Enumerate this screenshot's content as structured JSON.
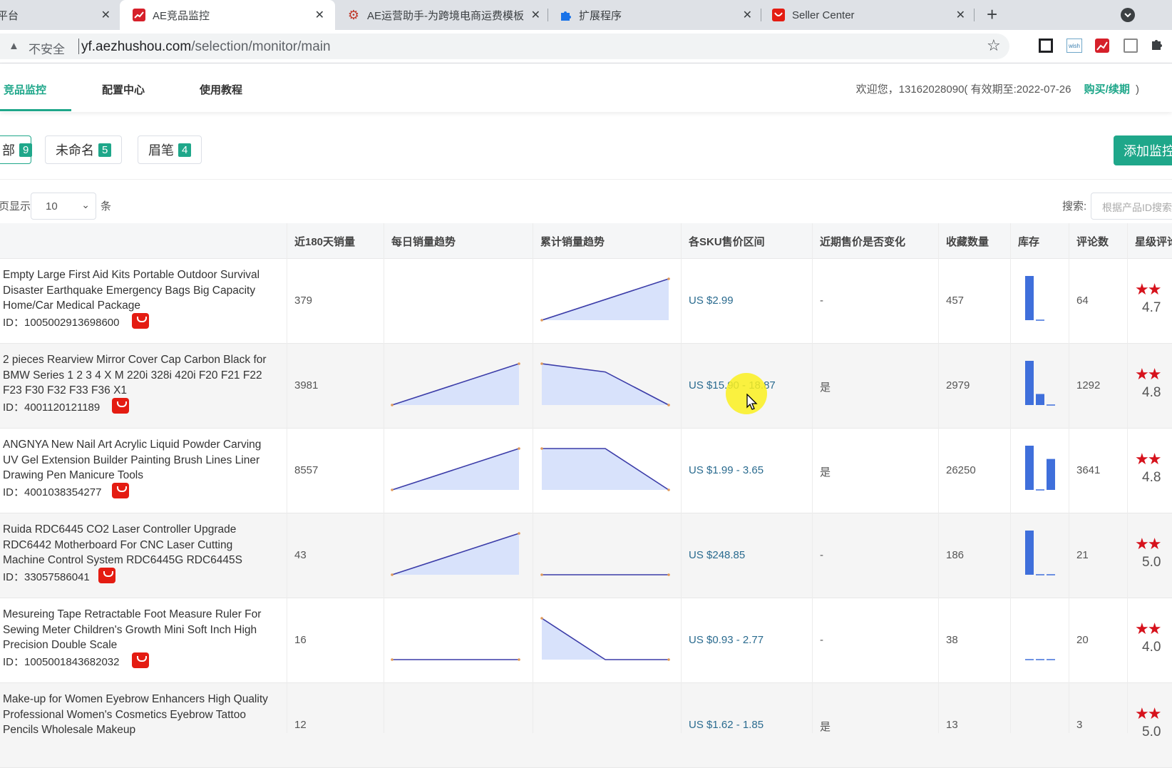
{
  "browser": {
    "tabs": [
      {
        "title": "平台",
        "active": false,
        "icon": "partial-tab"
      },
      {
        "title": "AE竞品监控",
        "active": true,
        "icon": "chart-icon"
      },
      {
        "title": "AE运营助手-为跨境电商运费模板",
        "active": false,
        "icon": "gear-icon"
      },
      {
        "title": "扩展程序",
        "active": false,
        "icon": "puzzle-icon"
      },
      {
        "title": "Seller Center",
        "active": false,
        "icon": "aliexpress-icon"
      }
    ],
    "security_label": "不安全",
    "url_host": "yf.aezhushou.com",
    "url_path": "/selection/monitor/main"
  },
  "app": {
    "nav": [
      {
        "label": "竞品监控",
        "active": true
      },
      {
        "label": "配置中心",
        "active": false
      },
      {
        "label": "使用教程",
        "active": false
      }
    ],
    "welcome_prefix": "欢迎您，13162028090( 有效期至:2022-07-26",
    "renew_label": "购买/续期",
    "welcome_suffix": ")",
    "accent_color": "#1fa78a"
  },
  "groups": [
    {
      "label": "部",
      "count": "9",
      "selected": true
    },
    {
      "label": "未命名",
      "count": "5",
      "selected": false
    },
    {
      "label": "眉笔",
      "count": "4",
      "selected": false
    }
  ],
  "add_button_label": "添加监控",
  "pager": {
    "prefix": "页显示",
    "value": "10",
    "suffix": "条"
  },
  "search": {
    "label": "搜索:",
    "placeholder": "根据产品ID搜索"
  },
  "table": {
    "headers": [
      "近180天销量",
      "每日销量趋势",
      "累计销量趋势",
      "各SKU售价区间",
      "近期售价是否变化",
      "收藏数量",
      "库存",
      "评论数",
      "星级评论"
    ],
    "rows": [
      {
        "title": "Empty Large First Aid Kits Portable Outdoor Survival Disaster Earthquake Emergency Bags Big Capacity Home/Car Medical Package",
        "id": "ID：1005002913698600",
        "sales": "379",
        "daily": [],
        "cumulative": [
          0,
          1
        ],
        "price": "US $2.99",
        "changed": "-",
        "favorites": "457",
        "stock": [
          1,
          0
        ],
        "reviews": "64",
        "stars": "★★",
        "rating": "4.7"
      },
      {
        "title": "2 pieces Rearview Mirror Cover Cap Carbon Black for BMW Series 1 2 3 4 X M 220i 328i 420i F20 F21 F22 F23 F30 F32 F33 F36 X1",
        "id": "ID：4001120121189",
        "sales": "3981",
        "daily": [
          0,
          1
        ],
        "cumulative": [
          1,
          0.8,
          0
        ],
        "price": "US $15.90 - 18.87",
        "changed": "是",
        "favorites": "2979",
        "stock": [
          1,
          0.25,
          0
        ],
        "reviews": "1292",
        "stars": "★★",
        "rating": "4.8"
      },
      {
        "title": "ANGNYA New Nail Art Acrylic Liquid Powder Carving UV Gel Extension Builder Painting Brush Lines Liner Drawing Pen Manicure Tools",
        "id": "ID：4001038354277",
        "sales": "8557",
        "daily": [
          0,
          1
        ],
        "cumulative": [
          1,
          1,
          0
        ],
        "price": "US $1.99 - 3.65",
        "changed": "是",
        "favorites": "26250",
        "stock": [
          1,
          0,
          0.7
        ],
        "reviews": "3641",
        "stars": "★★",
        "rating": "4.8"
      },
      {
        "title": "Ruida RDC6445 CO2 Laser Controller Upgrade RDC6442 Motherboard For CNC Laser Cutting Machine Control System RDC6445G RDC6445S",
        "id": "ID：33057586041",
        "sales": "43",
        "daily": [
          0,
          1
        ],
        "cumulative": [
          0,
          0,
          0
        ],
        "price": "US $248.85",
        "changed": "-",
        "favorites": "186",
        "stock": [
          1,
          0,
          0
        ],
        "reviews": "21",
        "stars": "★★",
        "rating": "5.0"
      },
      {
        "title": "Mesureing Tape Retractable Foot Measure Ruler For Sewing Meter Children's Growth Mini Soft Inch High Precision Double Scale",
        "id": "ID：1005001843682032",
        "sales": "16",
        "daily": [
          0,
          0
        ],
        "cumulative": [
          1,
          0,
          0
        ],
        "price": "US $0.93 - 2.77",
        "changed": "-",
        "favorites": "38",
        "stock": [
          0,
          0,
          0
        ],
        "reviews": "20",
        "stars": "★★",
        "rating": "4.0"
      },
      {
        "title": "Make-up for Women Eyebrow Enhancers High Quality Professional Women's Cosmetics Eyebrow Tattoo Pencils Wholesale Makeup",
        "id": "",
        "sales": "12",
        "daily": [],
        "cumulative": [],
        "price": "US $1.62 - 1.85",
        "changed": "是",
        "favorites": "13",
        "stock": [],
        "reviews": "3",
        "stars": "★★",
        "rating": "5.0"
      }
    ]
  }
}
